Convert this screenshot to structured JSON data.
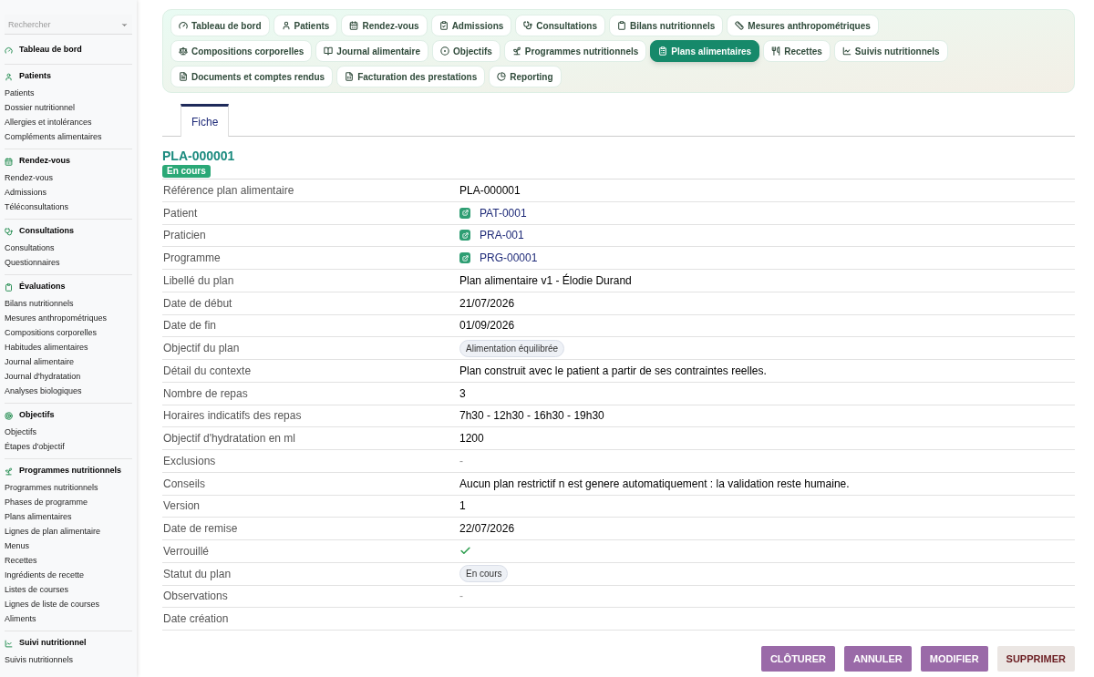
{
  "sidebar": {
    "search": {
      "placeholder": "Rechercher"
    },
    "sections": [
      {
        "title": "Tableau de bord"
      },
      {
        "title": "Patients",
        "items": [
          "Patients",
          "Dossier nutritionnel",
          "Allergies et intolérances",
          "Compléments alimentaires"
        ]
      },
      {
        "title": "Rendez-vous",
        "items": [
          "Rendez-vous",
          "Admissions",
          "Téléconsultations"
        ]
      },
      {
        "title": "Consultations",
        "items": [
          "Consultations",
          "Questionnaires"
        ]
      },
      {
        "title": "Évaluations",
        "items": [
          "Bilans nutritionnels",
          "Mesures anthropométriques",
          "Compositions corporelles",
          "Habitudes alimentaires",
          "Journal alimentaire",
          "Journal d'hydratation",
          "Analyses biologiques"
        ]
      },
      {
        "title": "Objectifs",
        "items": [
          "Objectifs",
          "Étapes d'objectif"
        ]
      },
      {
        "title": "Programmes nutritionnels",
        "items": [
          "Programmes nutritionnels",
          "Phases de programme",
          "Plans alimentaires",
          "Lignes de plan alimentaire",
          "Menus",
          "Recettes",
          "Ingrédients de recette",
          "Listes de courses",
          "Lignes de liste de courses",
          "Aliments"
        ]
      },
      {
        "title": "Suivi nutritionnel",
        "items": [
          "Suivis nutritionnels"
        ]
      }
    ]
  },
  "nav": [
    {
      "label": "Tableau de bord",
      "selected": false
    },
    {
      "label": "Patients",
      "selected": false
    },
    {
      "label": "Rendez-vous",
      "selected": false
    },
    {
      "label": "Admissions",
      "selected": false
    },
    {
      "label": "Consultations",
      "selected": false
    },
    {
      "label": "Bilans nutritionnels",
      "selected": false
    },
    {
      "label": "Mesures anthropométriques",
      "selected": false
    },
    {
      "label": "Compositions corporelles",
      "selected": false
    },
    {
      "label": "Journal alimentaire",
      "selected": false
    },
    {
      "label": "Objectifs",
      "selected": false
    },
    {
      "label": "Programmes nutritionnels",
      "selected": false
    },
    {
      "label": "Plans alimentaires",
      "selected": true
    },
    {
      "label": "Recettes",
      "selected": false
    },
    {
      "label": "Suivis nutritionnels",
      "selected": false
    },
    {
      "label": "Documents et comptes rendus",
      "selected": false
    },
    {
      "label": "Facturation des prestations",
      "selected": false
    },
    {
      "label": "Reporting",
      "selected": false
    }
  ],
  "tabs": [
    {
      "label": "Fiche",
      "selected": true
    }
  ],
  "record": {
    "title": "PLA-000001",
    "status": "En cours"
  },
  "fields": [
    {
      "label": "Référence plan alimentaire",
      "kind": "text",
      "value": "PLA-000001"
    },
    {
      "label": "Patient",
      "kind": "link",
      "value": "PAT-0001"
    },
    {
      "label": "Praticien",
      "kind": "link",
      "value": "PRA-001"
    },
    {
      "label": "Programme",
      "kind": "link",
      "value": "PRG-00001"
    },
    {
      "label": "Libellé du plan",
      "kind": "text",
      "value": "Plan alimentaire v1 - Élodie Durand"
    },
    {
      "label": "Date de début",
      "kind": "text",
      "value": "21/07/2026"
    },
    {
      "label": "Date de fin",
      "kind": "text",
      "value": "01/09/2026"
    },
    {
      "label": "Objectif du plan",
      "kind": "tag",
      "value": "Alimentation équilibrée"
    },
    {
      "label": "Détail du contexte",
      "kind": "text",
      "value": "Plan construit avec le patient a partir de ses contraintes reelles."
    },
    {
      "label": "Nombre de repas",
      "kind": "text",
      "value": "3"
    },
    {
      "label": "Horaires indicatifs des repas",
      "kind": "text",
      "value": "7h30 - 12h30 - 16h30 - 19h30"
    },
    {
      "label": "Objectif d'hydratation en ml",
      "kind": "text",
      "value": "1200"
    },
    {
      "label": "Exclusions",
      "kind": "empty",
      "value": "-"
    },
    {
      "label": "Conseils",
      "kind": "text",
      "value": "Aucun plan restrictif n est genere automatiquement : la validation reste humaine."
    },
    {
      "label": "Version",
      "kind": "text",
      "value": "1"
    },
    {
      "label": "Date de remise",
      "kind": "text",
      "value": "22/07/2026"
    },
    {
      "label": "Verrouillé",
      "kind": "check",
      "checked": true
    },
    {
      "label": "Statut du plan",
      "kind": "tag",
      "value": "En cours"
    },
    {
      "label": "Observations",
      "kind": "empty",
      "value": "-"
    },
    {
      "label": "Date création",
      "kind": "blank"
    }
  ],
  "actions": [
    {
      "label": "CLÔTURER",
      "kind": "primary"
    },
    {
      "label": "ANNULER",
      "kind": "primary"
    },
    {
      "label": "MODIFIER",
      "kind": "primary"
    },
    {
      "label": "SUPPRIMER",
      "kind": "danger"
    }
  ]
}
